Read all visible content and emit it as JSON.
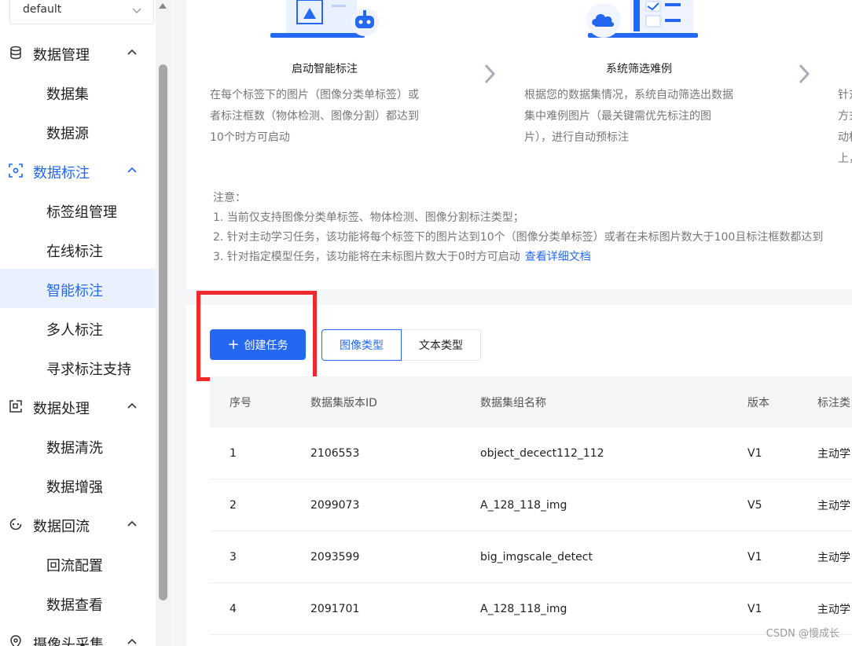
{
  "workspace_select": {
    "value": "default"
  },
  "sidebar": {
    "groups": [
      {
        "label": "数据管理",
        "icon": "database-icon",
        "items": [
          "数据集",
          "数据源"
        ]
      },
      {
        "label": "数据标注",
        "icon": "annotate-icon",
        "items": [
          "标签组管理",
          "在线标注",
          "智能标注",
          "多人标注",
          "寻求标注支持"
        ]
      },
      {
        "label": "数据处理",
        "icon": "process-icon",
        "items": [
          "数据清洗",
          "数据增强"
        ]
      },
      {
        "label": "数据回流",
        "icon": "backflow-icon",
        "items": [
          "回流配置",
          "数据查看"
        ]
      },
      {
        "label": "摄像头采集",
        "icon": "location-pin-icon",
        "items": []
      }
    ],
    "selected_item": "智能标注"
  },
  "steps": [
    {
      "title": "启动智能标注",
      "desc": [
        "在每个标签下的图片（图像分类单标签）或",
        "者标注框数（物体检测、图像分割）都达到",
        "10个时方可启动"
      ]
    },
    {
      "title": "系统筛选难例",
      "desc": [
        "根据您的数据集情况，系统自动筛选出数据",
        "集中难例图片（最关键需优先标注的图",
        "片），进行自动预标注"
      ]
    },
    {
      "title": "",
      "desc": [
        "针对",
        "方式",
        "动标",
        "上，"
      ]
    }
  ],
  "notes": {
    "title": "注意：",
    "lines": [
      "1. 当前仅支持图像分类单标签、物体检测、图像分割标注类型；",
      "2. 针对主动学习任务，该功能将每个标签下的图片达到10个（图像分类单标签）或者在未标图片数大于100且标注框数都达到",
      "3. 针对指定模型任务，该功能将在未标图片数大于0时方可启动"
    ],
    "link": "查看详细文档"
  },
  "toolbar": {
    "create_label": "创建任务",
    "tabs": [
      "图像类型",
      "文本类型"
    ],
    "active_tab": "图像类型"
  },
  "table": {
    "columns": [
      "序号",
      "数据集版本ID",
      "数据集组名称",
      "版本",
      "标注类"
    ],
    "rows": [
      [
        "1",
        "2106553",
        "object_decect112_112",
        "V1",
        "主动学"
      ],
      [
        "2",
        "2099073",
        "A_128_118_img",
        "V5",
        "主动学"
      ],
      [
        "3",
        "2093599",
        "big_imgscale_detect",
        "V1",
        "主动学"
      ],
      [
        "4",
        "2091701",
        "A_128_118_img",
        "V1",
        "主动学"
      ]
    ]
  },
  "watermark": "CSDN @慢成长",
  "colors": {
    "primary": "#2468f2",
    "highlight_box": "#f02a2a",
    "selected_bg": "#e9f0fe"
  }
}
